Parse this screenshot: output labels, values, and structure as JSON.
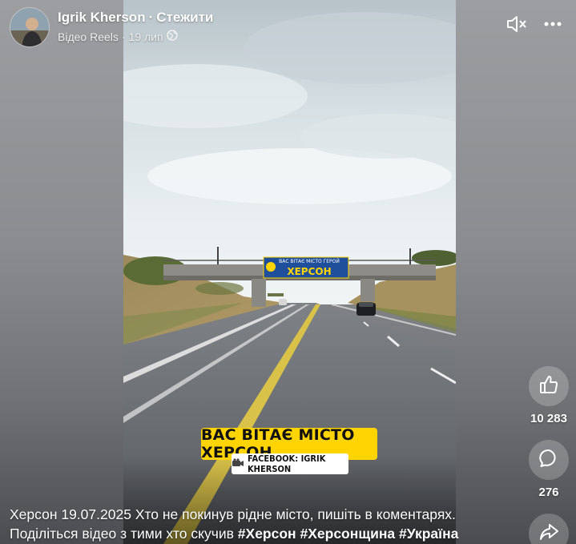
{
  "header": {
    "author_name": "Igrik Kherson",
    "separator": "·",
    "follow_label": "Стежити",
    "content_type": "Відео Reels",
    "date_separator": "·",
    "date": "19 лип",
    "privacy_icon": "globe-icon"
  },
  "controls": {
    "mute_icon": "speaker-muted-icon",
    "more_icon": "more-horizontal-icon"
  },
  "video": {
    "road_sign_top": "ВАС ВІТАЄ МІСТО ГЕРОЙ",
    "road_sign_main": "ХЕРСОН",
    "overlay_caption": "ВАС ВІТАЄ МІСТО ХЕРСОН",
    "overlay_credit": "FACEBOOK: IGRIK KHERSON"
  },
  "actions": {
    "like_count": "10 283",
    "comment_count": "276",
    "like_icon": "thumbs-up-icon",
    "comment_icon": "comment-bubble-icon",
    "share_icon": "share-arrow-icon"
  },
  "post": {
    "text_line1": "Херсон 19.07.2025 Хто не покинув рідне місто, пишіть в коментарях.",
    "text_line2_prefix": "Поділіться відео з тими хто скучив ",
    "hashtags": [
      "#Херсон",
      "#Херсонщина",
      "#Україна"
    ]
  },
  "colors": {
    "caption_yellow": "#ffd400",
    "sign_blue": "#1f4f9a",
    "sign_yellow": "#ffd400"
  }
}
